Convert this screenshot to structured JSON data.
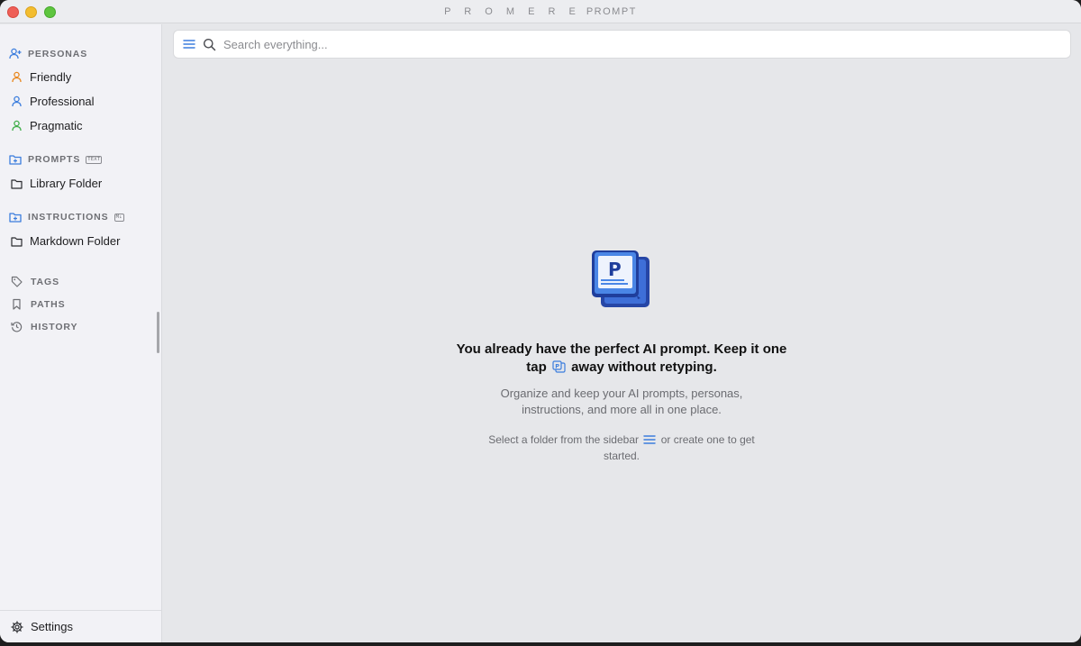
{
  "window": {
    "title_brand": "P R O M E R E",
    "title_app": "PROMPT"
  },
  "sidebar": {
    "personas": {
      "heading": "PERSONAS",
      "items": [
        {
          "label": "Friendly",
          "color": "#e8871e"
        },
        {
          "label": "Professional",
          "color": "#3b7ddd"
        },
        {
          "label": "Pragmatic",
          "color": "#3fae49"
        }
      ]
    },
    "prompts": {
      "heading": "PROMPTS",
      "badge": "TEXT",
      "items": [
        {
          "label": "Library Folder"
        }
      ]
    },
    "instructions": {
      "heading": "INSTRUCTIONS",
      "badge": "M↓",
      "items": [
        {
          "label": "Markdown Folder"
        }
      ]
    },
    "links": [
      {
        "label": "TAGS",
        "icon": "tag-icon"
      },
      {
        "label": "PATHS",
        "icon": "bookmark-icon"
      },
      {
        "label": "HISTORY",
        "icon": "history-icon"
      }
    ],
    "settings_label": "Settings"
  },
  "search": {
    "placeholder": "Search everything..."
  },
  "empty_state": {
    "headline_part1": "You already have the perfect AI prompt. Keep it one tap",
    "headline_part2": "away without retyping.",
    "subtext": "Organize and keep your AI prompts, personas, instructions, and more all in one place.",
    "hint_part1": "Select a folder from the sidebar",
    "hint_part2": "or create one to get started."
  },
  "colors": {
    "accent": "#3b7ddd",
    "logo_dark": "#1f3e9c",
    "logo_light": "#4a86e6"
  }
}
